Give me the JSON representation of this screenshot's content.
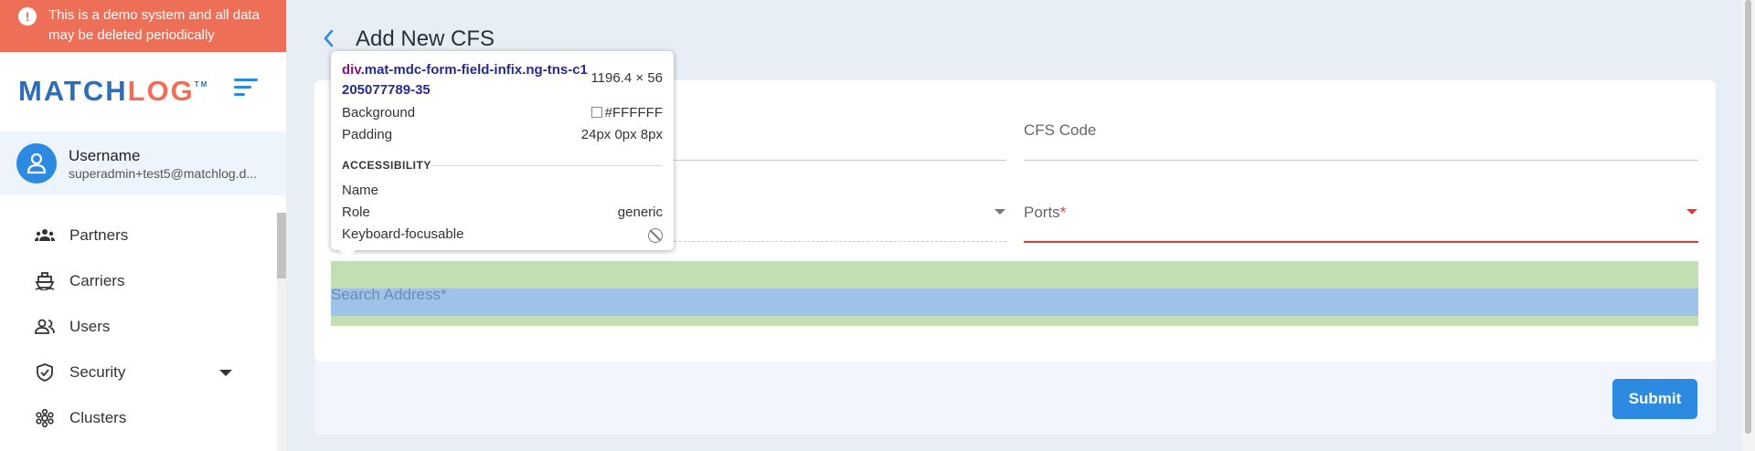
{
  "banner": {
    "text": "This is a demo system and all data may be deleted periodically",
    "icon": "warning-icon"
  },
  "brand": {
    "part1": "MATCH",
    "part2": "LOG",
    "tm": "TM",
    "color_primary": "#2c6fb7",
    "color_accent": "#ee6f57"
  },
  "user": {
    "name": "Username",
    "email": "superadmin+test5@matchlog.d..."
  },
  "sidebar": {
    "items": [
      {
        "label": "Partners",
        "icon": "partners-icon"
      },
      {
        "label": "Carriers",
        "icon": "ship-icon"
      },
      {
        "label": "Users",
        "icon": "users-icon"
      },
      {
        "label": "Security",
        "icon": "shield-icon",
        "expandable": true
      },
      {
        "label": "Clusters",
        "icon": "clusters-icon"
      }
    ]
  },
  "page": {
    "title": "Add New CFS"
  },
  "form": {
    "cfs_code_label": "CFS Code",
    "ports_label": "Ports",
    "required_mark": "*",
    "search_address_label": "Search Address",
    "submit_label": "Submit"
  },
  "inspector": {
    "tag": "div",
    "selector": ".mat-mdc-form-field-infix.ng-tns-c1205077789-35",
    "dimensions": "1196.4 × 56",
    "background_label": "Background",
    "background_value": "#FFFFFF",
    "padding_label": "Padding",
    "padding_value": "24px 0px 8px",
    "section_title": "ACCESSIBILITY",
    "name_label": "Name",
    "name_value": "",
    "role_label": "Role",
    "role_value": "generic",
    "focusable_label": "Keyboard-focusable"
  },
  "colors": {
    "primary": "#2c8ae0",
    "error": "#e53935",
    "page_bg": "#e8eef6"
  }
}
